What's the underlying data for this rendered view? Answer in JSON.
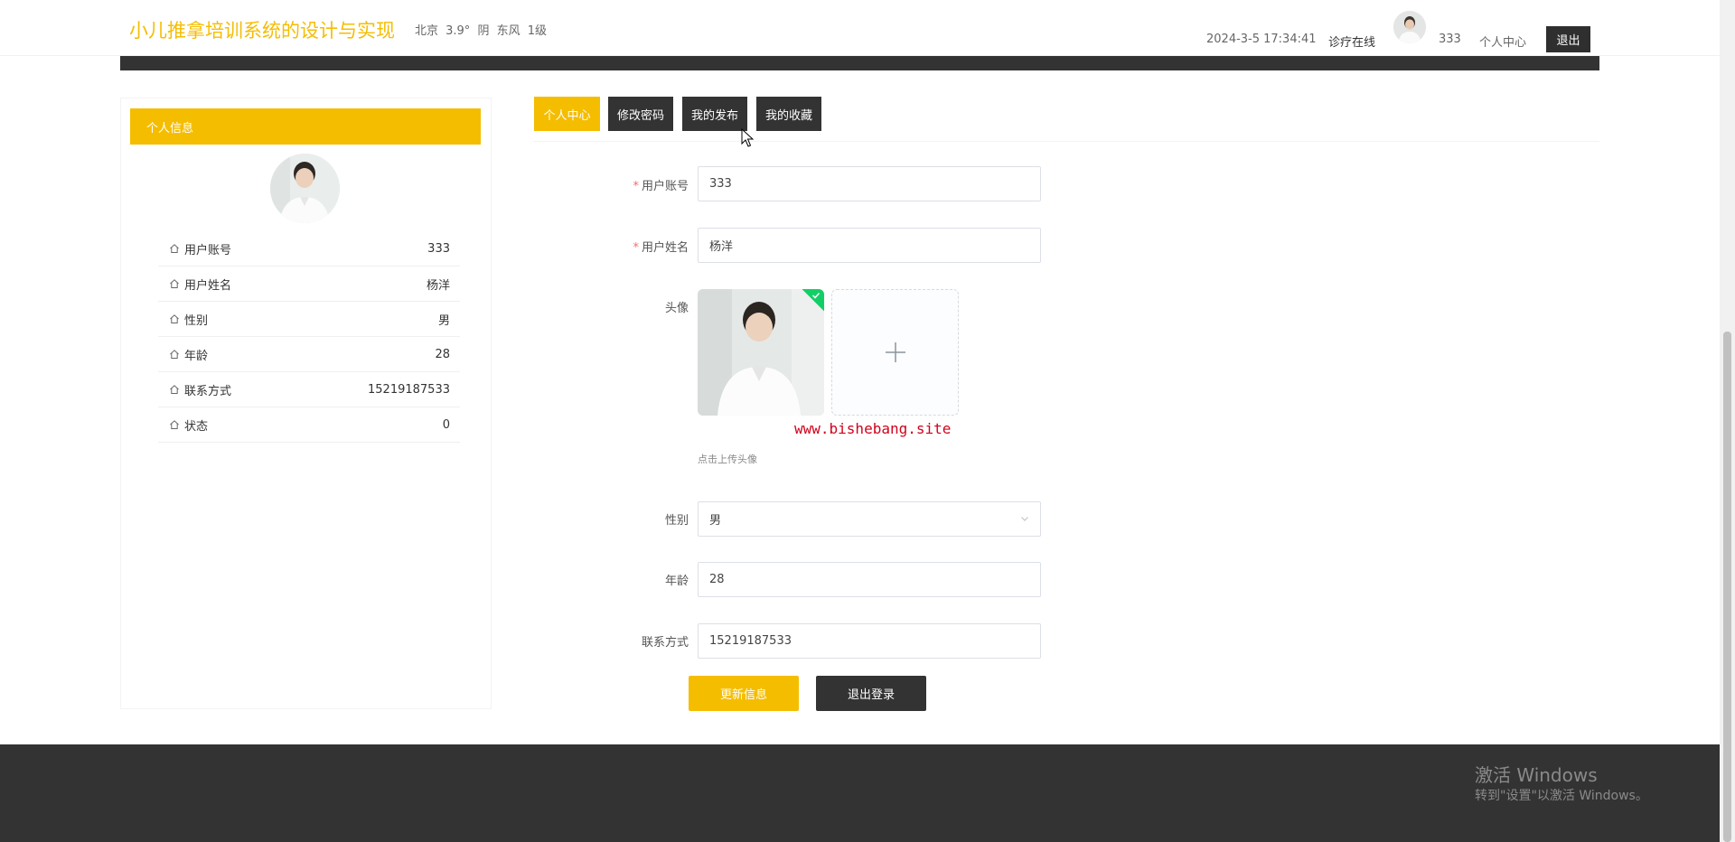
{
  "header": {
    "site_title": "小儿推拿培训系统的设计与实现",
    "weather": "北京 3.9° 阴 东风 1级",
    "datetime": "2024-3-5 17:34:41",
    "online_label": "诊疗在线",
    "username": "333",
    "personal_center": "个人中心",
    "logout": "退出"
  },
  "left_panel": {
    "title": "个人信息",
    "rows": [
      {
        "label": "用户账号",
        "value": "333"
      },
      {
        "label": "用户姓名",
        "value": "杨洋"
      },
      {
        "label": "性别",
        "value": "男"
      },
      {
        "label": "年龄",
        "value": "28"
      },
      {
        "label": "联系方式",
        "value": "15219187533"
      },
      {
        "label": "状态",
        "value": "0"
      }
    ]
  },
  "tabs": [
    {
      "label": "个人中心"
    },
    {
      "label": "修改密码"
    },
    {
      "label": "我的发布"
    },
    {
      "label": "我的收藏"
    }
  ],
  "form": {
    "account_label": "用户账号",
    "account_value": "333",
    "name_label": "用户姓名",
    "name_value": "杨洋",
    "avatar_label": "头像",
    "upload_tip": "点击上传头像",
    "watermark": "www.bishebang.site",
    "gender_label": "性别",
    "gender_value": "男",
    "age_label": "年龄",
    "age_value": "28",
    "phone_label": "联系方式",
    "phone_value": "15219187533",
    "update_button": "更新信息",
    "logout_button": "退出登录"
  },
  "windows_watermark": {
    "line1": "激活 Windows",
    "line2": "转到\"设置\"以激活 Windows。"
  },
  "colors": {
    "accent": "#f5bd00",
    "dark": "#333333",
    "success": "#13ce66"
  }
}
